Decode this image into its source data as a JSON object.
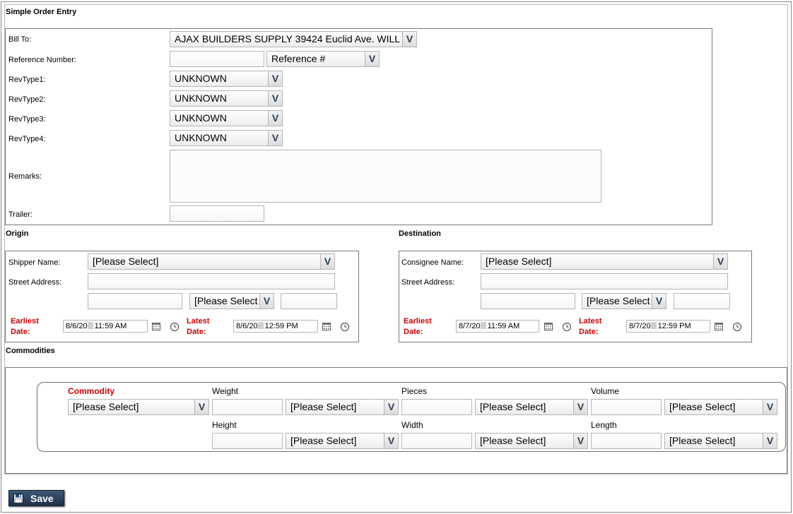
{
  "form": {
    "title": "Simple Order Entry"
  },
  "order": {
    "bill_to_label": "Bill To:",
    "bill_to_value": "AJAX BUILDERS SUPPLY 39424 Euclid Ave. WILL",
    "reference_number_label": "Reference Number:",
    "reference_number_value": "",
    "reference_type_value": "Reference #",
    "revtype1_label": "RevType1:",
    "revtype1_value": "UNKNOWN",
    "revtype2_label": "RevType2:",
    "revtype2_value": "UNKNOWN",
    "revtype3_label": "RevType3:",
    "revtype3_value": "UNKNOWN",
    "revtype4_label": "RevType4:",
    "revtype4_value": "UNKNOWN",
    "remarks_label": "Remarks:",
    "remarks_value": "",
    "trailer_label": "Trailer:",
    "trailer_value": ""
  },
  "origin": {
    "title": "Origin",
    "name_label": "Shipper Name:",
    "name_value": "[Please Select]",
    "street_label": "Street Address:",
    "street_value": "",
    "city_value": "",
    "state_value": "[Please Select",
    "zip_value": "",
    "earliest_label_1": "Earliest",
    "earliest_label_2": "Date:",
    "earliest_date": "8/6/20",
    "earliest_time": "11:59 AM",
    "latest_label_1": "Latest",
    "latest_label_2": "Date:",
    "latest_date": "8/6/20",
    "latest_time": "12:59 PM"
  },
  "destination": {
    "title": "Destination",
    "name_label": "Consignee Name:",
    "name_value": "[Please Select]",
    "street_label": "Street Address:",
    "street_value": "",
    "city_value": "",
    "state_value": "[Please Select",
    "zip_value": "",
    "earliest_label_1": "Earliest",
    "earliest_label_2": "Date:",
    "earliest_date": "8/7/20",
    "earliest_time": "11:59 AM",
    "latest_label_1": "Latest",
    "latest_label_2": "Date:",
    "latest_date": "8/7/20",
    "latest_time": "12:59 PM"
  },
  "commodities": {
    "title": "Commodities",
    "commodity_label": "Commodity",
    "commodity_value": "[Please Select]",
    "weight_label": "Weight",
    "weight_unit": "[Please Select]",
    "pieces_label": "Pieces",
    "pieces_unit": "[Please Select]",
    "volume_label": "Volume",
    "volume_unit": "[Please Select]",
    "height_label": "Height",
    "height_unit": "[Please Select]",
    "width_label": "Width",
    "width_unit": "[Please Select]",
    "length_label": "Length",
    "length_unit": "[Please Select]"
  },
  "actions": {
    "save_label": "Save",
    "dropdown_glyph": "V"
  },
  "icons": {
    "calendar": "calendar-icon",
    "clock": "clock-icon",
    "save": "floppy-disk-icon"
  },
  "colors": {
    "required_label": "#cc0000",
    "button_bg": "#2b4260",
    "dropdown_arrow": "#2e3f55"
  }
}
